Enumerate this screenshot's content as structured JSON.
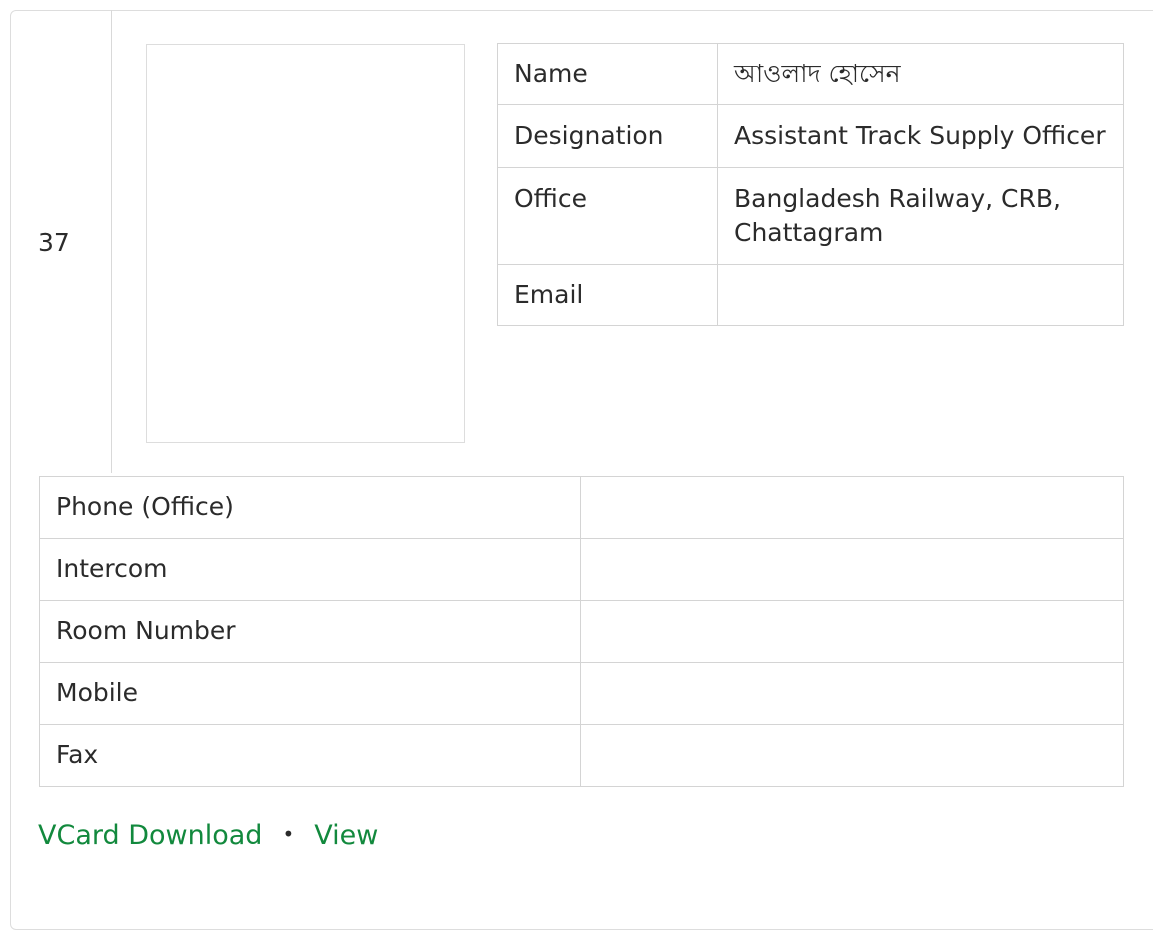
{
  "entry": {
    "serial": "37"
  },
  "profile": {
    "rows": [
      {
        "label": "Name",
        "value": "আওলাদ হোসেন"
      },
      {
        "label": "Designation",
        "value": "Assistant Track Supply Officer"
      },
      {
        "label": "Office",
        "value": "Bangladesh Railway, CRB, Chattagram"
      },
      {
        "label": "Email",
        "value": ""
      }
    ]
  },
  "contacts": {
    "rows": [
      {
        "label": "Phone (Office)",
        "value": ""
      },
      {
        "label": "Intercom",
        "value": ""
      },
      {
        "label": "Room Number",
        "value": ""
      },
      {
        "label": "Mobile",
        "value": ""
      },
      {
        "label": "Fax",
        "value": ""
      }
    ]
  },
  "actions": {
    "vcard_label": "VCard Download",
    "separator": "•",
    "view_label": "View",
    "link_color": "#12893d"
  }
}
